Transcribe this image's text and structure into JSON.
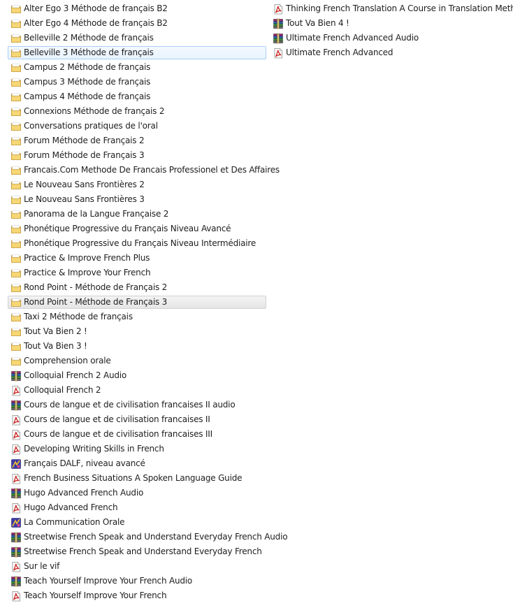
{
  "left_column": [
    {
      "label": "Alter Ego 3 Méthode de français B2",
      "icon": "folder-icon",
      "selected": ""
    },
    {
      "label": "Alter Ego 4 Méthode de français B2",
      "icon": "folder-icon",
      "selected": ""
    },
    {
      "label": "Belleville 2 Méthode de français",
      "icon": "folder-icon",
      "selected": ""
    },
    {
      "label": "Belleville 3 Méthode de français",
      "icon": "folder-icon",
      "selected": "blue"
    },
    {
      "label": "Campus 2 Méthode de français",
      "icon": "folder-icon",
      "selected": ""
    },
    {
      "label": "Campus 3 Méthode de français",
      "icon": "folder-icon",
      "selected": ""
    },
    {
      "label": "Campus 4 Méthode de français",
      "icon": "folder-icon",
      "selected": ""
    },
    {
      "label": "Connexions Méthode de français 2",
      "icon": "folder-icon",
      "selected": ""
    },
    {
      "label": "Conversations pratiques de l'oral",
      "icon": "folder-icon",
      "selected": ""
    },
    {
      "label": "Forum Méthode de Français 2",
      "icon": "folder-icon",
      "selected": ""
    },
    {
      "label": "Forum Méthode de Français 3",
      "icon": "folder-icon",
      "selected": ""
    },
    {
      "label": "Francais.Com Methode De Francais Professionel et Des Affaires",
      "icon": "folder-icon",
      "selected": ""
    },
    {
      "label": "Le Nouveau Sans Frontières 2",
      "icon": "folder-icon",
      "selected": ""
    },
    {
      "label": "Le Nouveau Sans Frontières 3",
      "icon": "folder-icon",
      "selected": ""
    },
    {
      "label": "Panorama de la Langue Française 2",
      "icon": "folder-icon",
      "selected": ""
    },
    {
      "label": "Phonétique Progressive du Français Niveau Avancé",
      "icon": "folder-icon",
      "selected": ""
    },
    {
      "label": "Phonétique Progressive du Français Niveau Intermédiaire",
      "icon": "folder-icon",
      "selected": ""
    },
    {
      "label": "Practice & Improve French Plus",
      "icon": "folder-icon",
      "selected": ""
    },
    {
      "label": "Practice & Improve Your French",
      "icon": "folder-icon",
      "selected": ""
    },
    {
      "label": "Rond Point - Méthode de Français 2",
      "icon": "folder-icon",
      "selected": ""
    },
    {
      "label": "Rond Point - Méthode de Français 3",
      "icon": "folder-icon",
      "selected": "gray"
    },
    {
      "label": "Taxi 2 Méthode de français",
      "icon": "folder-icon",
      "selected": ""
    },
    {
      "label": "Tout Va Bien 2 !",
      "icon": "folder-icon",
      "selected": ""
    },
    {
      "label": "Tout Va Bien 3 !",
      "icon": "folder-icon",
      "selected": ""
    },
    {
      "label": "Comprehension orale",
      "icon": "folder-icon",
      "selected": ""
    },
    {
      "label": "Colloquial French 2 Audio",
      "icon": "rar-archive-icon",
      "selected": ""
    },
    {
      "label": "Colloquial French 2",
      "icon": "pdf-icon",
      "selected": ""
    },
    {
      "label": "Cours de langue et de civilisation francaises II audio",
      "icon": "rar-archive-icon",
      "selected": ""
    },
    {
      "label": "Cours de langue et de civilisation francaises II",
      "icon": "pdf-icon",
      "selected": ""
    },
    {
      "label": "Cours de langue et de civilisation francaises III",
      "icon": "pdf-icon",
      "selected": ""
    },
    {
      "label": "Developing Writing Skills in French",
      "icon": "pdf-icon",
      "selected": ""
    },
    {
      "label": "Français DALF, niveau avancé",
      "icon": "djvu-icon",
      "selected": ""
    },
    {
      "label": "French Business Situations A Spoken Language Guide",
      "icon": "pdf-icon",
      "selected": ""
    },
    {
      "label": "Hugo Advanced French Audio",
      "icon": "rar-archive-icon",
      "selected": ""
    },
    {
      "label": "Hugo Advanced French",
      "icon": "pdf-icon",
      "selected": ""
    },
    {
      "label": "La Communication Orale",
      "icon": "djvu-icon",
      "selected": ""
    },
    {
      "label": "Streetwise French Speak and Understand Everyday French Audio",
      "icon": "rar-archive-icon",
      "selected": ""
    },
    {
      "label": "Streetwise French Speak and Understand Everyday French",
      "icon": "rar-archive-icon",
      "selected": ""
    },
    {
      "label": "Sur le vif",
      "icon": "pdf-icon",
      "selected": ""
    },
    {
      "label": "Teach Yourself Improve Your French Audio",
      "icon": "rar-archive-icon",
      "selected": ""
    },
    {
      "label": "Teach Yourself Improve Your French",
      "icon": "pdf-icon",
      "selected": ""
    }
  ],
  "right_column": [
    {
      "label": "Thinking French Translation A Course in Translation Method",
      "icon": "pdf-icon",
      "selected": ""
    },
    {
      "label": "Tout Va Bien 4 !",
      "icon": "rar-archive-icon",
      "selected": ""
    },
    {
      "label": "Ultimate French Advanced Audio",
      "icon": "rar-archive-icon",
      "selected": ""
    },
    {
      "label": "Ultimate French Advanced",
      "icon": "pdf-icon",
      "selected": ""
    }
  ],
  "colors": {
    "selection_blue_border": "#a9d0f5",
    "selection_gray_border": "#d3d3d3",
    "folder": "#e8c25a",
    "pdf_red": "#c8201c"
  }
}
